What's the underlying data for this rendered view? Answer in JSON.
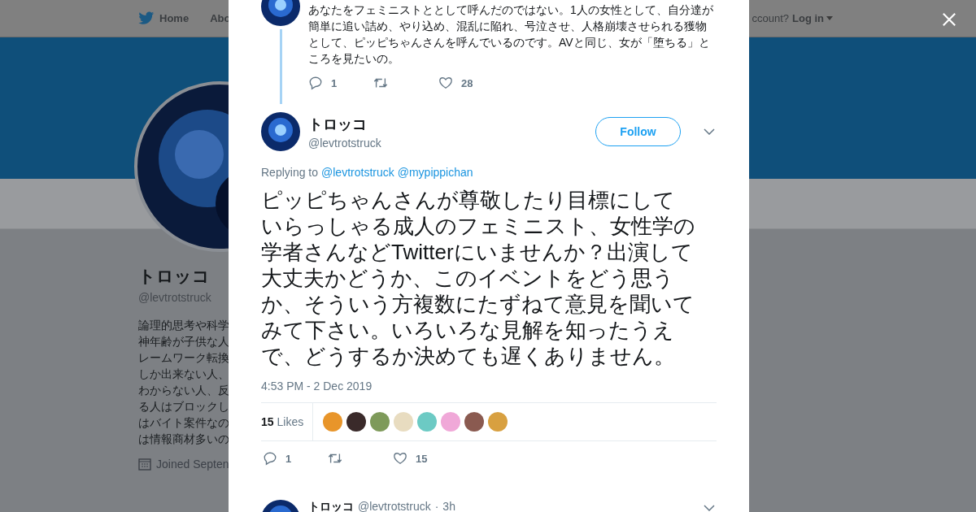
{
  "background_page": {
    "nav": [
      {
        "label": "Home",
        "kind": "home"
      },
      {
        "label": "Abo",
        "kind": "plain"
      }
    ],
    "account_prompt": "ccount?",
    "login": "Log in",
    "profile": {
      "name": "トロッコ",
      "handle": "@levtrotstruck",
      "bio_lines": [
        "論理的思考や科学",
        "神年齢が子供な人",
        "レームワーク転換",
        "しか出来ない人、",
        "わからない人、反",
        "る人はブロックし",
        "はバイト案件なの",
        "は情報商材多いの"
      ],
      "joined": "Joined Septen"
    }
  },
  "previous_tweet": {
    "text_lines": [
      "あなたをフェミニストととして呼んだのではない。1人の女性として、自分達が",
      "簡単に追い詰め、やり込め、混乱に陥れ、号泣させ、人格崩壊させられる獲物",
      "として、ピッピちゃんさんを呼んでいるのです。AVと同じ、女が「堕ちる」と",
      "ころを見たいの。"
    ],
    "replies": "1",
    "likes": "28"
  },
  "main_tweet": {
    "name": "トロッコ",
    "handle": "@levtrotstruck",
    "follow": "Follow",
    "replying_label": "Replying to",
    "replying_to": [
      "@levtrotstruck",
      "@mypippichan"
    ],
    "text_lines": [
      "ピッピちゃんさんが尊敬したり目標にして",
      "いらっしゃる成人のフェミニスト、女性学の",
      "学者さんなどTwitterにいませんか？出演して",
      "大丈夫かどうか、このイベントをどう思う",
      "か、そういう方複数にたずねて意見を聞いて",
      "みて下さい。いろいろな見解を知ったうえ",
      "で、どうするか決めても遅くありません。"
    ],
    "time": "4:53 PM - 2 Dec 2019",
    "likes_count": "15",
    "likes_label": "Likes",
    "likers": [
      {
        "color": "#e8952a"
      },
      {
        "color": "#3a2a2a"
      },
      {
        "color": "#7e9a5a"
      },
      {
        "color": "#e8dcc0"
      },
      {
        "color": "#6ccac4"
      },
      {
        "color": "#f0a8d8"
      },
      {
        "color": "#8a5a50"
      },
      {
        "color": "#d8a040"
      }
    ],
    "replies": "1",
    "favorites": "15"
  },
  "next_tweet": {
    "name": "トロッコ",
    "handle": "@levtrotstruck",
    "separator": "·",
    "age": "3h"
  }
}
